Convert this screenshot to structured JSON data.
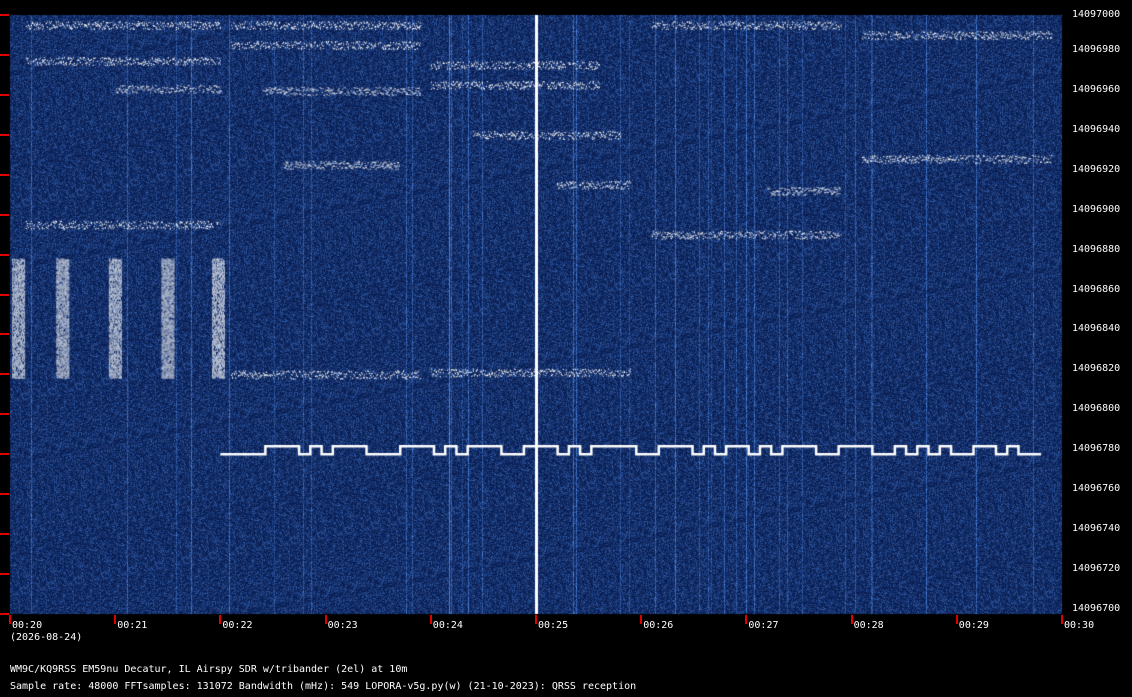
{
  "chart_data": {
    "type": "heatmap",
    "title": "",
    "xlabel": "",
    "ylabel": "",
    "x_ticks": [
      "00:20",
      "00:21",
      "00:22",
      "00:23",
      "00:24",
      "00:25",
      "00:26",
      "00:27",
      "00:28",
      "00:29",
      "00:30"
    ],
    "date_label": "(2026-08-24)",
    "y_ticks": [
      14097000,
      14096980,
      14096960,
      14096940,
      14096920,
      14096900,
      14096880,
      14096860,
      14096840,
      14096820,
      14096800,
      14096780,
      14096760,
      14096740,
      14096720,
      14096700
    ],
    "y_tick_labels": [
      "14097000",
      "14096980",
      "14096960",
      "14096940",
      "14096920",
      "14096900",
      "14096880",
      "14096860",
      "14096840",
      "14096820",
      "14096800",
      "14096780",
      "14096760",
      "14096740",
      "14096720",
      "14096700"
    ],
    "ylim": [
      14096700,
      14097000
    ],
    "colors": {
      "background": "#0a1f55",
      "noise": "#1a3f8a",
      "signal": "#ffffff",
      "tick": "#e00000"
    },
    "signals": [
      {
        "t0": 0.15,
        "t1": 2.0,
        "f": 14096995
      },
      {
        "t0": 0.15,
        "t1": 2.0,
        "f": 14096977
      },
      {
        "t0": 1.0,
        "t1": 2.0,
        "f": 14096963
      },
      {
        "t0": 2.1,
        "t1": 3.9,
        "f": 14096995
      },
      {
        "t0": 2.1,
        "t1": 3.9,
        "f": 14096985
      },
      {
        "t0": 2.4,
        "t1": 3.9,
        "f": 14096962
      },
      {
        "t0": 2.6,
        "t1": 3.7,
        "f": 14096925
      },
      {
        "t0": 2.1,
        "t1": 3.9,
        "f": 14096820
      },
      {
        "t0": 4.0,
        "t1": 5.6,
        "f": 14096975
      },
      {
        "t0": 4.0,
        "t1": 5.6,
        "f": 14096965
      },
      {
        "t0": 4.4,
        "t1": 5.8,
        "f": 14096940
      },
      {
        "t0": 5.2,
        "t1": 5.9,
        "f": 14096915
      },
      {
        "t0": 4.0,
        "t1": 5.9,
        "f": 14096821
      },
      {
        "t0": 6.1,
        "t1": 7.9,
        "f": 14096995
      },
      {
        "t0": 6.1,
        "t1": 7.9,
        "f": 14096890
      },
      {
        "t0": 7.2,
        "t1": 7.9,
        "f": 14096912
      },
      {
        "t0": 8.1,
        "t1": 9.9,
        "f": 14096990
      },
      {
        "t0": 8.1,
        "t1": 9.9,
        "f": 14096928
      },
      {
        "t0": 0.15,
        "t1": 2.0,
        "f": 14096895
      }
    ],
    "bursts": {
      "f_center": 14096848,
      "f_half": 30,
      "times": [
        0.08,
        0.5,
        1.0,
        1.5,
        1.98
      ],
      "width": 0.12
    },
    "carrier_t": 5.0,
    "fsk": {
      "t0": 2.0,
      "t1": 9.8,
      "f_low": 14096780,
      "f_high": 14096784,
      "pattern": [
        0,
        0,
        0,
        0,
        1,
        1,
        1,
        0,
        1,
        0,
        1,
        1,
        1,
        0,
        0,
        0,
        1,
        1,
        1,
        0,
        1,
        0,
        1,
        1,
        1,
        0,
        0,
        1,
        1,
        1,
        0,
        1,
        0,
        1,
        1,
        1,
        1,
        0,
        0,
        1,
        1,
        1,
        0,
        1,
        0,
        1,
        1,
        0,
        1,
        0,
        1,
        1,
        1,
        0,
        0,
        1,
        1,
        1,
        0,
        0,
        1,
        0,
        1,
        0,
        1,
        0,
        0,
        1,
        1,
        0,
        1,
        0,
        0
      ]
    }
  },
  "info": {
    "station": "WM9C/KQ9RSS EM59nu Decatur, IL  Airspy SDR w/tribander (2el) at 10m",
    "params": "Sample rate: 48000   FFTsamples: 131072   Bandwidth (mHz): 549      LOPORA-v5g.py(w) (21-10-2023): QRSS reception"
  }
}
